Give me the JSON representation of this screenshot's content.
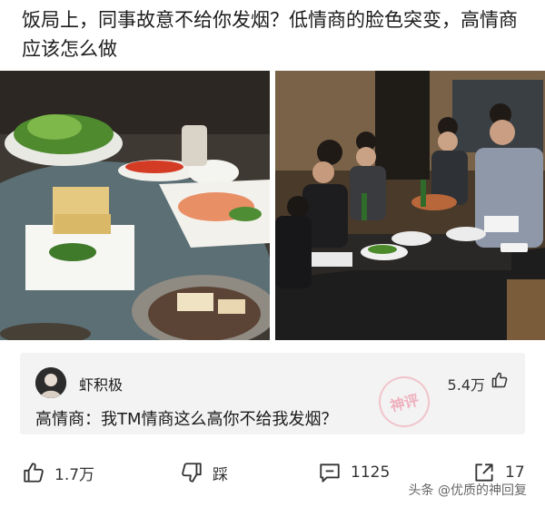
{
  "post": {
    "title": "饭局上，同事故意不给你发烟？低情商的脸色突变，高情商应该怎么做"
  },
  "images": [
    {
      "name": "dinner-table-food-photo"
    },
    {
      "name": "group-drinking-photo"
    }
  ],
  "comment": {
    "username": "虾积极",
    "like_count": "5.4万",
    "text": "高情商：我TM情商这么高你不给我发烟？",
    "stamp_text": "神评"
  },
  "actions": {
    "like": "1.7万",
    "dislike": "踩",
    "comment": "1125",
    "share": "17"
  },
  "watermark": "头条 @优质的神回复",
  "icons": {
    "like": "thumbs-up-icon",
    "dislike": "thumbs-down-icon",
    "comment": "comment-icon",
    "share": "share-icon"
  }
}
